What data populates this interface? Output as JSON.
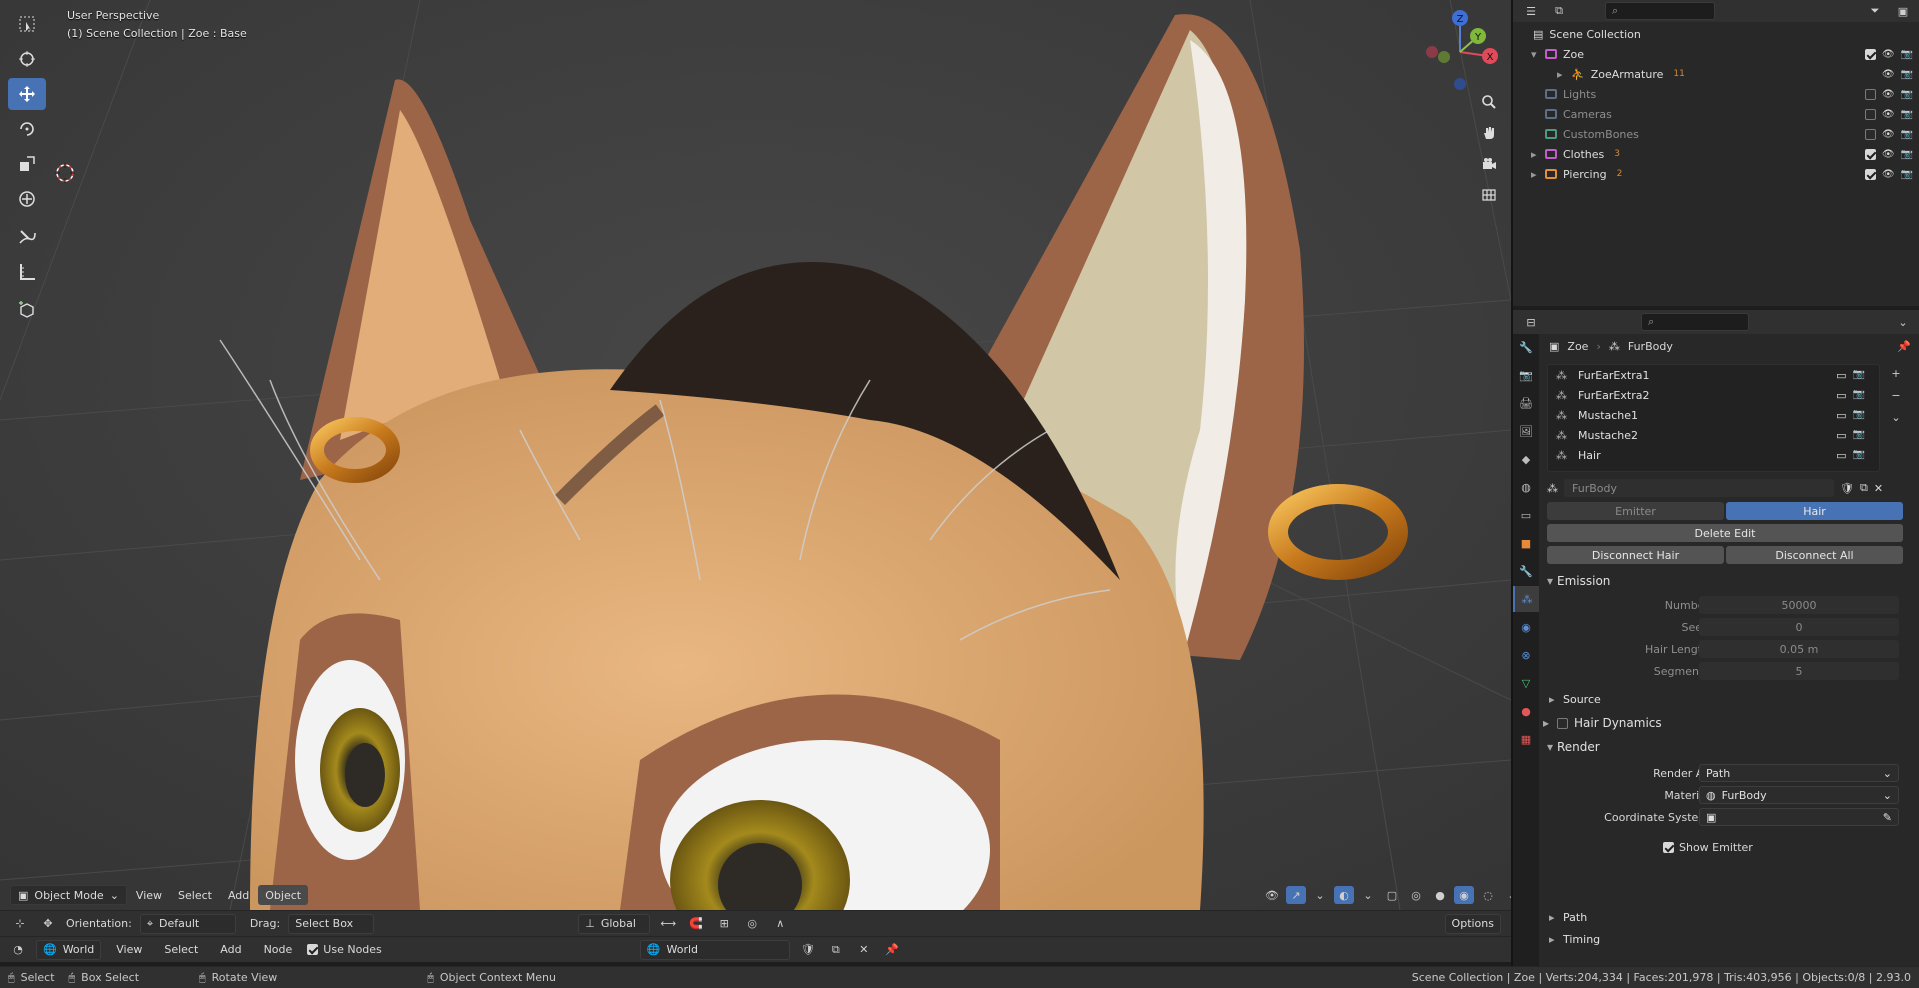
{
  "viewport": {
    "title": "User Perspective",
    "subtitle": "(1) Scene Collection | Zoe : Base",
    "gizmo": {
      "z": "Z",
      "x": "X",
      "y": "Y"
    },
    "header": {
      "mode": "Object Mode",
      "menus": [
        "View",
        "Select",
        "Add",
        "Object"
      ]
    }
  },
  "tool_settings": {
    "orientation_label": "Orientation:",
    "orientation_value": "Default",
    "drag_label": "Drag:",
    "drag_value": "Select Box",
    "transform_orientation": "Global",
    "options": "Options"
  },
  "shader_header": {
    "world_type": "World",
    "menus": [
      "View",
      "Select",
      "Add",
      "Node"
    ],
    "use_nodes_label": "Use Nodes",
    "use_nodes_checked": true,
    "world_name": "World"
  },
  "status": {
    "select": "Select",
    "box_select": "Box Select",
    "rotate_view": "Rotate View",
    "context_menu": "Object Context Menu",
    "stats": "Scene Collection | Zoe | Verts:204,334 | Faces:201,978 | Tris:403,956 | Objects:0/8 | 2.93.0"
  },
  "outliner": {
    "root": "Scene Collection",
    "items": [
      {
        "name": "Zoe",
        "color": "#c25ec9",
        "checked": true,
        "expanded": true
      },
      {
        "name": "ZoeArmature",
        "sub": true,
        "badge": "11"
      },
      {
        "name": "Lights",
        "color": "#5b6f86",
        "checked": false,
        "dim": true
      },
      {
        "name": "Cameras",
        "color": "#5b6f86",
        "checked": false,
        "dim": true
      },
      {
        "name": "CustomBones",
        "color": "#4f9a7c",
        "checked": false,
        "dim": true
      },
      {
        "name": "Clothes",
        "color": "#c25ec9",
        "checked": true,
        "badge": "3"
      },
      {
        "name": "Piercing",
        "color": "#e0903c",
        "checked": true,
        "badge": "2"
      }
    ]
  },
  "properties": {
    "breadcrumb_object": "Zoe",
    "breadcrumb_system": "FurBody",
    "particle_systems": [
      "FurEarExtra1",
      "FurEarExtra2",
      "Mustache1",
      "Mustache2",
      "Hair"
    ],
    "settings_name": "FurBody",
    "type_emitter": "Emitter",
    "type_hair": "Hair",
    "delete_edit": "Delete Edit",
    "disconnect_hair": "Disconnect Hair",
    "disconnect_all": "Disconnect All",
    "emission": {
      "title": "Emission",
      "rows": [
        {
          "label": "Number",
          "value": "50000"
        },
        {
          "label": "Seed",
          "value": "0"
        },
        {
          "label": "Hair Length",
          "value": "0.05 m"
        },
        {
          "label": "Segments",
          "value": "5"
        }
      ]
    },
    "source": "Source",
    "hair_dynamics": "Hair Dynamics",
    "render": {
      "title": "Render",
      "render_as_label": "Render As",
      "render_as_value": "Path",
      "material_label": "Material",
      "material_value": "FurBody",
      "coord_label": "Coordinate System",
      "show_emitter": "Show Emitter"
    },
    "path": "Path",
    "timing": "Timing"
  }
}
